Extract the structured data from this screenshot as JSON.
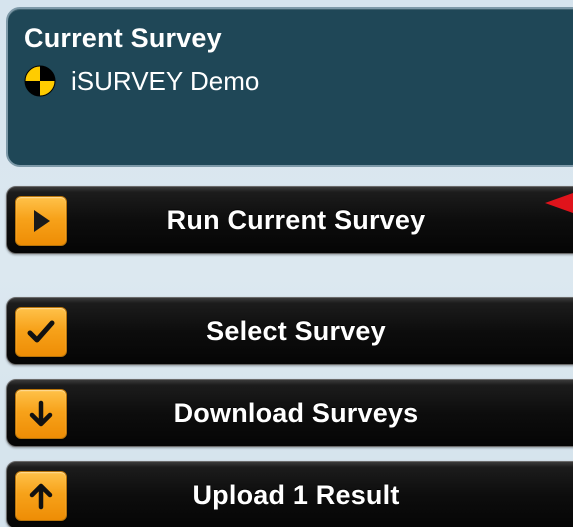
{
  "current_survey": {
    "title": "Current Survey",
    "survey_name": "iSURVEY Demo",
    "icon": "crash-test-target-icon"
  },
  "menu": [
    {
      "label": "Run Current Survey",
      "icon": "play-icon"
    },
    {
      "label": "Select Survey",
      "icon": "checkmark-icon"
    },
    {
      "label": "Download Surveys",
      "icon": "arrow-down-icon"
    },
    {
      "label": "Upload 1 Result",
      "icon": "arrow-up-icon"
    }
  ],
  "colors": {
    "background": "#d6e4ee",
    "panel": "#1f4757",
    "panel_border": "#7d99a8",
    "button": "#0d0d0d",
    "icon_orange": "#f7a21a",
    "pointer_red": "#e0131b"
  }
}
